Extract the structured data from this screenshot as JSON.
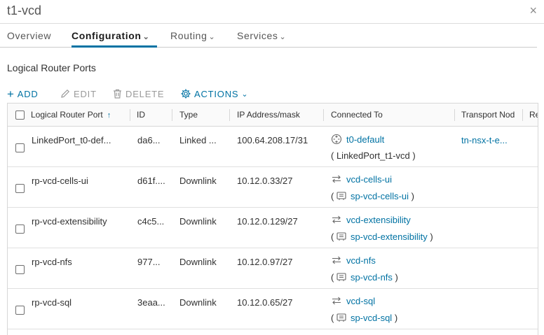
{
  "window": {
    "title": "t1-vcd",
    "close_glyph": "×"
  },
  "tabs": [
    {
      "label": "Overview",
      "chevron": ""
    },
    {
      "label": "Configuration",
      "chevron": "⌄"
    },
    {
      "label": "Routing",
      "chevron": "⌄"
    },
    {
      "label": "Services",
      "chevron": "⌄"
    }
  ],
  "section_title": "Logical Router Ports",
  "toolbar": {
    "add": "ADD",
    "edit": "EDIT",
    "delete": "DELETE",
    "actions": "ACTIONS"
  },
  "columns": [
    "Logical Router Port",
    "ID",
    "Type",
    "IP Address/mask",
    "Connected To",
    "Transport Nod",
    "Re"
  ],
  "rows": [
    {
      "port": "LinkedPort_t0-def...",
      "id": "da6...",
      "type": "Linked ...",
      "ip": "100.64.208.17/31",
      "connected": "t0-default",
      "connected_sub": "LinkedPort_t1-vcd",
      "sub_is_link": false,
      "router_icon": true,
      "transport": "tn-nsx-t-e..."
    },
    {
      "port": "rp-vcd-cells-ui",
      "id": "d61f....",
      "type": "Downlink",
      "ip": "10.12.0.33/27",
      "connected": "vcd-cells-ui",
      "connected_sub": "sp-vcd-cells-ui",
      "sub_is_link": true,
      "router_icon": false,
      "transport": ""
    },
    {
      "port": "rp-vcd-extensibility",
      "id": "c4c5...",
      "type": "Downlink",
      "ip": "10.12.0.129/27",
      "connected": "vcd-extensibility",
      "connected_sub": "sp-vcd-extensibility",
      "sub_is_link": true,
      "router_icon": false,
      "transport": ""
    },
    {
      "port": "rp-vcd-nfs",
      "id": "977...",
      "type": "Downlink",
      "ip": "10.12.0.97/27",
      "connected": "vcd-nfs",
      "connected_sub": "sp-vcd-nfs",
      "sub_is_link": true,
      "router_icon": false,
      "transport": ""
    },
    {
      "port": "rp-vcd-sql",
      "id": "3eaa...",
      "type": "Downlink",
      "ip": "10.12.0.65/27",
      "connected": "vcd-sql",
      "connected_sub": "sp-vcd-sql",
      "sub_is_link": true,
      "router_icon": false,
      "transport": ""
    }
  ],
  "colors": {
    "accent": "#0072a3",
    "disabled": "#9a9a9a",
    "border": "#d7d7d7"
  },
  "icons": {
    "add": "plus-icon",
    "edit": "pencil-icon",
    "delete": "trash-icon",
    "actions": "gear-icon",
    "switch": "switch-arrows-icon",
    "port": "port-icon",
    "router": "router-icon"
  }
}
